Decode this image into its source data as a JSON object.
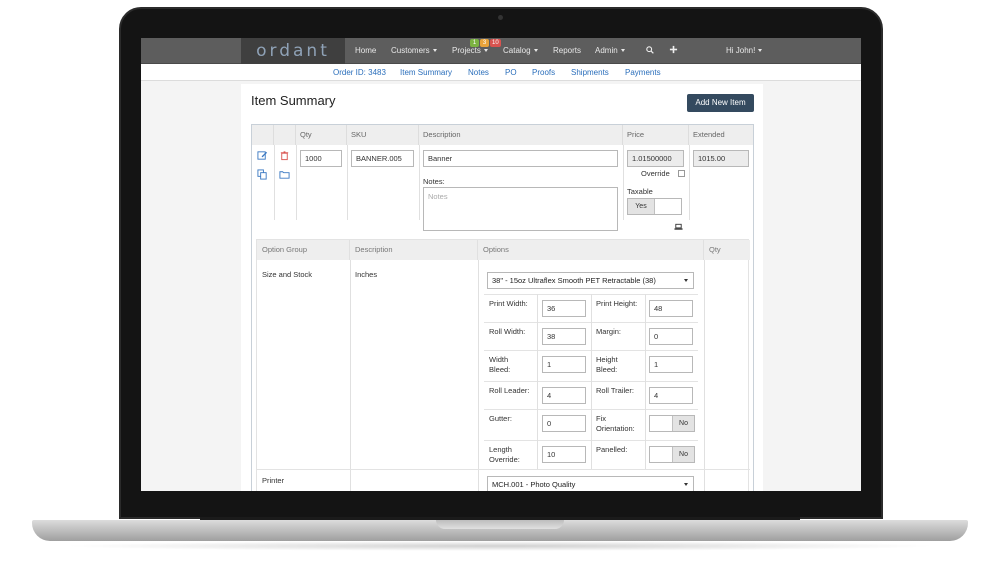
{
  "navbar": {
    "brand": "ordant",
    "items": {
      "home": "Home",
      "customers": "Customers",
      "projects": "Projects",
      "catalog": "Catalog",
      "reports": "Reports",
      "admin": "Admin",
      "user": "Hi John!"
    },
    "badges": [
      "1",
      "3",
      "10"
    ],
    "badge_colors": [
      "#7cb342",
      "#f0a030",
      "#d9534f"
    ]
  },
  "subnav": {
    "order_id": "Order ID: 3483",
    "item_summary": "Item Summary",
    "notes": "Notes",
    "po": "PO",
    "proofs": "Proofs",
    "shipments": "Shipments",
    "payments": "Payments"
  },
  "page": {
    "title": "Item Summary",
    "add_button": "Add New Item"
  },
  "item_table": {
    "headers": {
      "qty": "Qty",
      "sku": "SKU",
      "description": "Description",
      "price": "Price",
      "extended": "Extended"
    },
    "row": {
      "qty": "1000",
      "sku": "BANNER.005",
      "description": "Banner",
      "notes_label": "Notes:",
      "notes_placeholder": "Notes",
      "price": "1.01500000",
      "override_label": "Override",
      "taxable_label": "Taxable",
      "taxable_value": "Yes",
      "extended": "1015.00"
    }
  },
  "options_table": {
    "headers": {
      "group": "Option Group",
      "description": "Description",
      "options": "Options",
      "qty": "Qty"
    },
    "size_row": {
      "group": "Size and Stock",
      "description": "Inches",
      "stock_select": "38\" - 15oz Ultraflex Smooth PET Retractable (38)",
      "fields": {
        "print_width_label": "Print Width:",
        "print_width": "36",
        "print_height_label": "Print Height:",
        "print_height": "48",
        "roll_width_label": "Roll Width:",
        "roll_width": "38",
        "margin_label": "Margin:",
        "margin": "0",
        "width_bleed_label_1": "Width",
        "width_bleed_label_2": "Bleed:",
        "width_bleed": "1",
        "height_bleed_label_1": "Height",
        "height_bleed_label_2": "Bleed:",
        "height_bleed": "1",
        "roll_leader_label": "Roll Leader:",
        "roll_leader": "4",
        "roll_trailer_label": "Roll Trailer:",
        "roll_trailer": "4",
        "gutter_label": "Gutter:",
        "gutter": "0",
        "fix_orientation_label_1": "Fix",
        "fix_orientation_label_2": "Orientation:",
        "fix_orientation": "No",
        "length_override_label_1": "Length",
        "length_override_label_2": "Override:",
        "length_override": "10",
        "panelled_label": "Panelled:",
        "panelled": "No"
      }
    },
    "printer_row": {
      "group": "Printer",
      "select": "MCH.001 - Photo Quality"
    }
  }
}
